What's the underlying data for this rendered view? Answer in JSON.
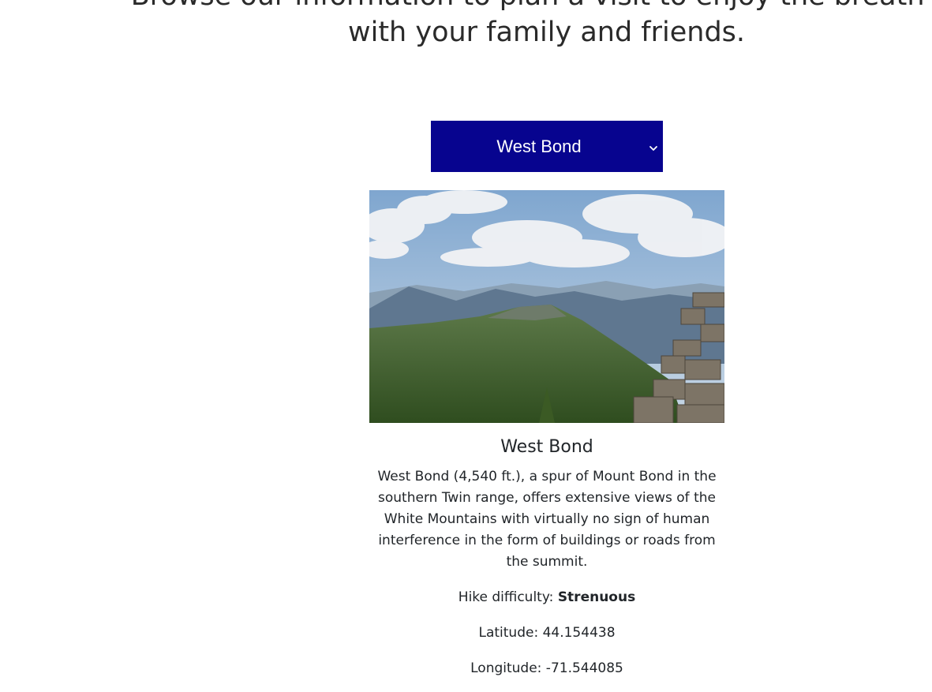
{
  "hero": {
    "line1": "Browse our information to plan a visit to enjoy the breath-ta",
    "line2": "with your family and friends."
  },
  "peak_select": {
    "selected": "West Bond"
  },
  "peak": {
    "image_alt": "West Bond summit view",
    "name": "West Bond",
    "description": "West Bond (4,540 ft.), a spur of Mount Bond in the southern Twin range, offers extensive views of the White Mountains with virtually no sign of human interference in the form of buildings or roads from the summit.",
    "difficulty_label": "Hike difficulty: ",
    "difficulty_value": "Strenuous",
    "latitude": "Latitude: 44.154438",
    "longitude": "Longitude: -71.544085"
  },
  "colors": {
    "select_bg": "#07048f",
    "text": "#212529"
  },
  "icons": {
    "dropdown": "chevron-down-icon"
  }
}
